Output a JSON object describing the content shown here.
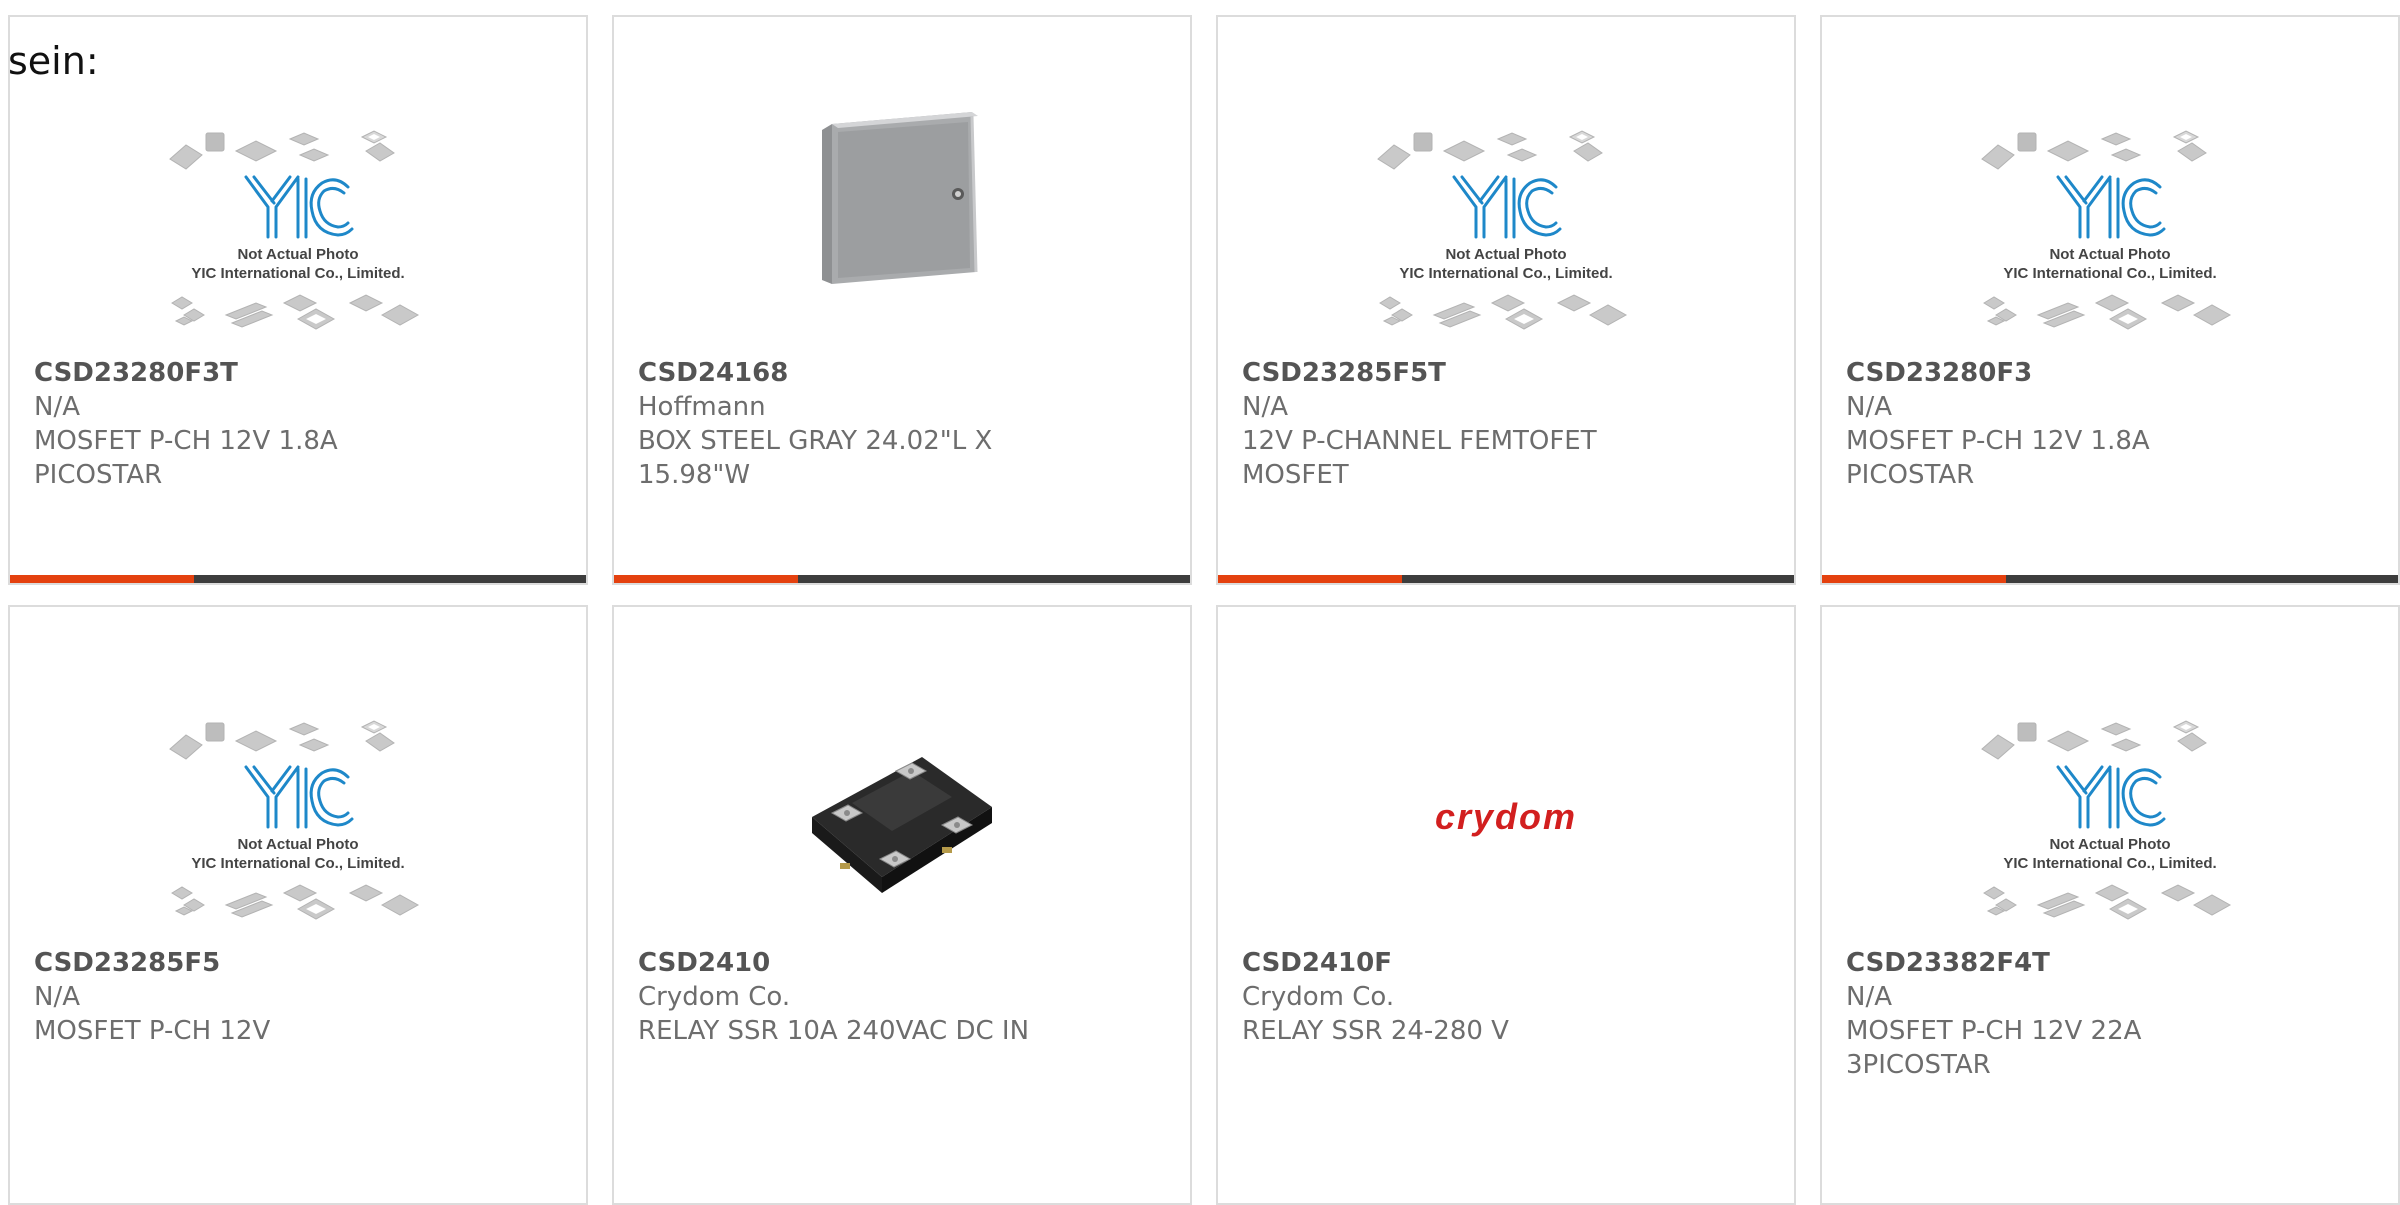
{
  "page": {
    "lead_text": "sein:"
  },
  "placeholder": {
    "logo_text": "YIC",
    "line1": "Not Actual Photo",
    "line2": "YIC International Co., Limited."
  },
  "products": [
    {
      "part": "CSD23280F3T",
      "maker": "N/A",
      "desc_line1": "MOSFET P-CH 12V 1.8A",
      "desc_line2": "PICOSTAR",
      "image": "yic-placeholder-image",
      "progress": 0.32
    },
    {
      "part": "CSD24168",
      "maker": "Hoffmann",
      "desc_line1": "BOX STEEL GRAY 24.02\"L X",
      "desc_line2": "15.98\"W",
      "image": "steel-enclosure-image",
      "progress": 0.32
    },
    {
      "part": "CSD23285F5T",
      "maker": "N/A",
      "desc_line1": "12V P-CHANNEL FEMTOFET",
      "desc_line2": "MOSFET",
      "image": "yic-placeholder-image",
      "progress": 0.32
    },
    {
      "part": "CSD23280F3",
      "maker": "N/A",
      "desc_line1": "MOSFET P-CH 12V 1.8A",
      "desc_line2": "PICOSTAR",
      "image": "yic-placeholder-image",
      "progress": 0.32
    },
    {
      "part": "CSD23285F5",
      "maker": "N/A",
      "desc_line1": "MOSFET P-CH 12V",
      "desc_line2": "",
      "image": "yic-placeholder-image"
    },
    {
      "part": "CSD2410",
      "maker": "Crydom Co.",
      "desc_line1": "RELAY SSR 10A 240VAC DC IN",
      "desc_line2": "",
      "image": "solid-state-relay-image"
    },
    {
      "part": "CSD2410F",
      "maker": "Crydom Co.",
      "desc_line1": "RELAY SSR 24-280 V",
      "desc_line2": "",
      "image": "crydom-logo-image",
      "logo_text": "crydom"
    },
    {
      "part": "CSD23382F4T",
      "maker": "N/A",
      "desc_line1": "MOSFET P-CH 12V 22A",
      "desc_line2": "3PICOSTAR",
      "image": "yic-placeholder-image"
    }
  ],
  "colors": {
    "accent": "#e4410f",
    "bar_track": "#3d3d3d",
    "yic_blue": "#1e88c9",
    "card_border": "#dcdcdc"
  }
}
